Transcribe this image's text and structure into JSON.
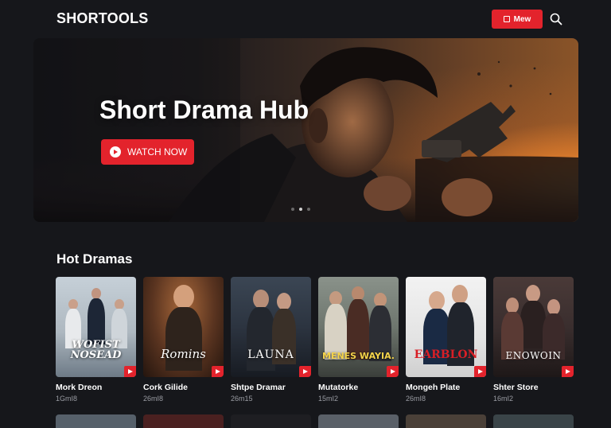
{
  "header": {
    "logo": "SHORTOOLS",
    "new_button_label": "Mew",
    "search_icon": "search-icon"
  },
  "hero": {
    "title": "Short Drama Hub",
    "watch_button_label": "WATCH NOW",
    "slide_count": 3,
    "active_slide": 2
  },
  "section": {
    "title": "Hot Dramas"
  },
  "cards": [
    {
      "name": "Mork Dreon",
      "meta": "1GmI8",
      "poster_text": "WOFIST NOSEAD",
      "poster_bg": "#c9d2da"
    },
    {
      "name": "Cork Gilide",
      "meta": "26mI8",
      "poster_text": "Romins",
      "poster_bg": "#5a3420"
    },
    {
      "name": "Shtpe Dramar",
      "meta": "26m15",
      "poster_text": "LAUNA",
      "poster_bg": "#2c3440"
    },
    {
      "name": "Mutatorke",
      "meta": "15mI2",
      "poster_text": "MENES WAYIA.",
      "poster_bg": "#707870"
    },
    {
      "name": "Mongeh Plate",
      "meta": "26mI8",
      "poster_text": "EARBLON",
      "poster_bg": "#e8e8e8"
    },
    {
      "name": "Shter Store",
      "meta": "16mI2",
      "poster_text": "ENOWOIN",
      "poster_bg": "#3a2e2e"
    }
  ],
  "colors": {
    "accent": "#e3232c",
    "background": "#16171b",
    "muted_text": "#9a9ca3"
  }
}
